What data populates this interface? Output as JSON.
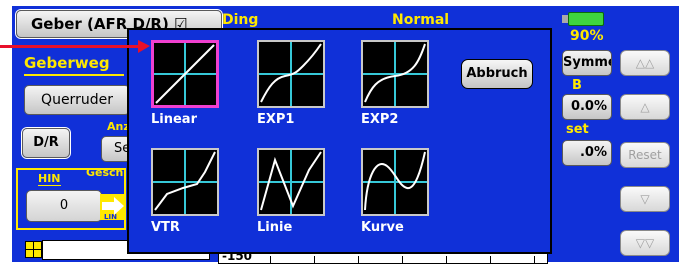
{
  "header": {
    "geber_button_label": "Geber (AFR D/R) ☑",
    "mixer_label": "Ding",
    "mode_label": "Normal"
  },
  "left_panel": {
    "geberweg_label": "Geberweg",
    "querruder_label": "Querruder",
    "dr_label": "D/R",
    "anzeige_label": "Anz",
    "se_label": "Se",
    "hin_label": "HIN",
    "gesch_label": "Gesch",
    "hin_value": "0",
    "lin_tag": "LIN"
  },
  "right_panel": {
    "value_90": "90%",
    "symmet_label": "Symmet.",
    "b_label": "B",
    "value_a": "0.0%",
    "set_label": "set",
    "value_b": ".0%",
    "nav_up2": "△△",
    "nav_up1": "△",
    "nav_reset": "Reset",
    "nav_down1": "▽",
    "nav_down2": "▽▽"
  },
  "scale": {
    "label": "-150"
  },
  "popup": {
    "abbruch_label": "Abbruch",
    "curves": [
      {
        "label": "Linear",
        "selected": true,
        "shape": "linear"
      },
      {
        "label": "EXP1",
        "selected": false,
        "shape": "exp1"
      },
      {
        "label": "EXP2",
        "selected": false,
        "shape": "exp2"
      },
      {
        "label": "VTR",
        "selected": false,
        "shape": "vtr"
      },
      {
        "label": "Linie",
        "selected": false,
        "shape": "linie"
      },
      {
        "label": "Kurve",
        "selected": false,
        "shape": "kurve"
      }
    ]
  },
  "colors": {
    "panel_blue": "#1030d8",
    "label_yellow": "#ffe800",
    "selection_magenta": "#f040d0",
    "grid_cyan": "#36c8d8",
    "arrow_red": "#e8102a",
    "battery_green": "#3fd43f"
  }
}
